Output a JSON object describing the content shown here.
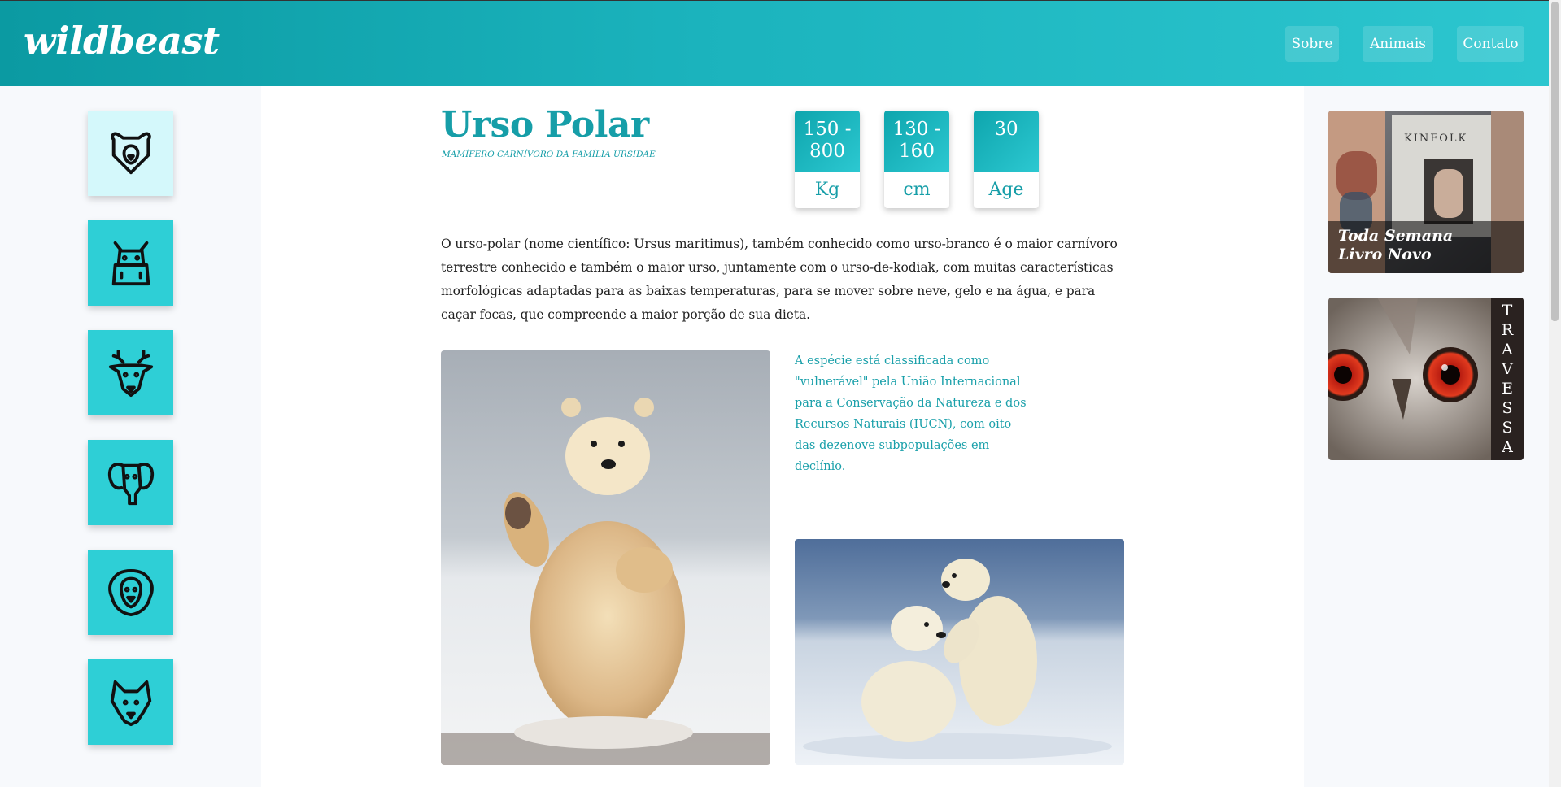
{
  "header": {
    "logo": "wildbeast",
    "nav": [
      "Sobre",
      "Animais",
      "Contato"
    ]
  },
  "sidebar": {
    "items": [
      {
        "icon": "bear-icon",
        "active": true
      },
      {
        "icon": "hippo-icon",
        "active": false
      },
      {
        "icon": "deer-icon",
        "active": false
      },
      {
        "icon": "elephant-icon",
        "active": false
      },
      {
        "icon": "lion-icon",
        "active": false
      },
      {
        "icon": "wolf-icon",
        "active": false
      }
    ]
  },
  "animal": {
    "name": "Urso Polar",
    "subtitle": "MAMÍFERO CARNÍVORO DA FAMÍLIA URSIDAE",
    "stats": [
      {
        "value": "150 -\n800",
        "unit": "Kg"
      },
      {
        "value": "130 -\n160",
        "unit": "cm"
      },
      {
        "value": "30",
        "unit": "Age"
      }
    ],
    "description": "O urso-polar (nome científico: Ursus maritimus), também conhecido como urso-branco é o maior carnívoro terrestre conhecido e também o maior urso, juntamente com o urso-de-kodiak, com muitas características morfológicas adaptadas para as baixas temperaturas, para se mover sobre neve, gelo e na água, e para caçar focas, que compreende a maior porção de sua dieta.",
    "quote": "A espécie está classificada como \"vulnerável\" pela União Internacional para a Conservação da Natureza e dos Recursos Naturais (IUCN), com oito das dezenove subpopulações em declínio."
  },
  "ads": [
    {
      "caption_line1": "Toda Semana",
      "caption_line2": "Livro Novo",
      "book_title": "KINFOLK"
    },
    {
      "vertical_text": "TRAVESSA"
    }
  ],
  "colors": {
    "accent": "#169ea8",
    "header_start": "#0b9aa2",
    "header_end": "#2cc6cf",
    "icon_bg": "#2ecfd6",
    "icon_bg_active": "#d4f8fb"
  }
}
